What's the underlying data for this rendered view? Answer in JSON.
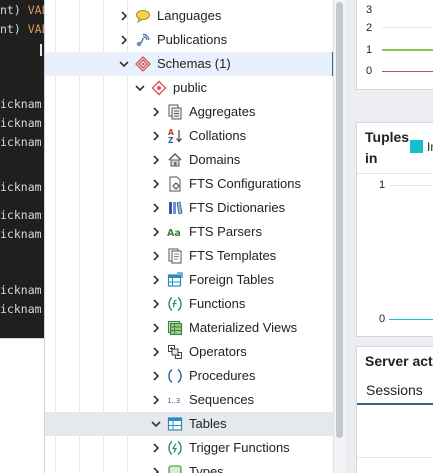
{
  "editor": {
    "lines": [
      {
        "pre": "nt) ",
        "kw": "VAL"
      },
      {
        "pre": "nt) ",
        "kw": "VAL"
      },
      {
        "pre": "icknam",
        "kw": ""
      },
      {
        "pre": "icknam",
        "kw": ""
      },
      {
        "pre": "icknam",
        "kw": ""
      },
      {
        "pre": "icknam",
        "kw": ""
      },
      {
        "pre": "icknam",
        "kw": ""
      },
      {
        "pre": "icknam",
        "kw": ""
      },
      {
        "pre": "icknam",
        "kw": ""
      },
      {
        "pre": "icknam",
        "kw": ""
      }
    ]
  },
  "tree": {
    "items": [
      {
        "label": "Languages",
        "icon": "languages-icon"
      },
      {
        "label": "Publications",
        "icon": "publications-icon"
      },
      {
        "label": "Schemas (1)",
        "icon": "schemas-icon"
      },
      {
        "label": "public",
        "icon": "schema-public-icon"
      },
      {
        "label": "Aggregates",
        "icon": "aggregates-icon"
      },
      {
        "label": "Collations",
        "icon": "collations-icon"
      },
      {
        "label": "Domains",
        "icon": "domains-icon"
      },
      {
        "label": "FTS Configurations",
        "icon": "fts-configurations-icon"
      },
      {
        "label": "FTS Dictionaries",
        "icon": "fts-dictionaries-icon"
      },
      {
        "label": "FTS Parsers",
        "icon": "fts-parsers-icon"
      },
      {
        "label": "FTS Templates",
        "icon": "fts-templates-icon"
      },
      {
        "label": "Foreign Tables",
        "icon": "foreign-tables-icon"
      },
      {
        "label": "Functions",
        "icon": "functions-icon"
      },
      {
        "label": "Materialized Views",
        "icon": "materialized-views-icon"
      },
      {
        "label": "Operators",
        "icon": "operators-icon"
      },
      {
        "label": "Procedures",
        "icon": "procedures-icon"
      },
      {
        "label": "Sequences",
        "icon": "sequences-icon"
      },
      {
        "label": "Tables",
        "icon": "tables-icon"
      },
      {
        "label": "Trigger Functions",
        "icon": "trigger-functions-icon"
      },
      {
        "label": "Types",
        "icon": "types-icon"
      }
    ],
    "fts_parsers_glyph": "Aa",
    "sequences_glyph": "1..3",
    "collations_glyph_top": "A",
    "collations_glyph_bottom": "Z"
  },
  "dashboard": {
    "top_chart": {
      "ticks": [
        "3",
        "2",
        "1",
        "0"
      ],
      "series_colors": [
        "#8bc34a",
        "#c0504d"
      ]
    },
    "tuples_in": {
      "title_line1": "Tuples",
      "title_line2": "in",
      "legend_label": "In",
      "legend_color": "#17becf",
      "ticks": [
        "1",
        "0"
      ]
    },
    "server_activity": {
      "title": "Server acti",
      "tab": "Sessions"
    }
  },
  "colors": {
    "accent": "#326690",
    "selected_bg": "#e8f0fb",
    "hover_bg": "#e5e8ec",
    "editor_bg": "#1f1f1f"
  }
}
